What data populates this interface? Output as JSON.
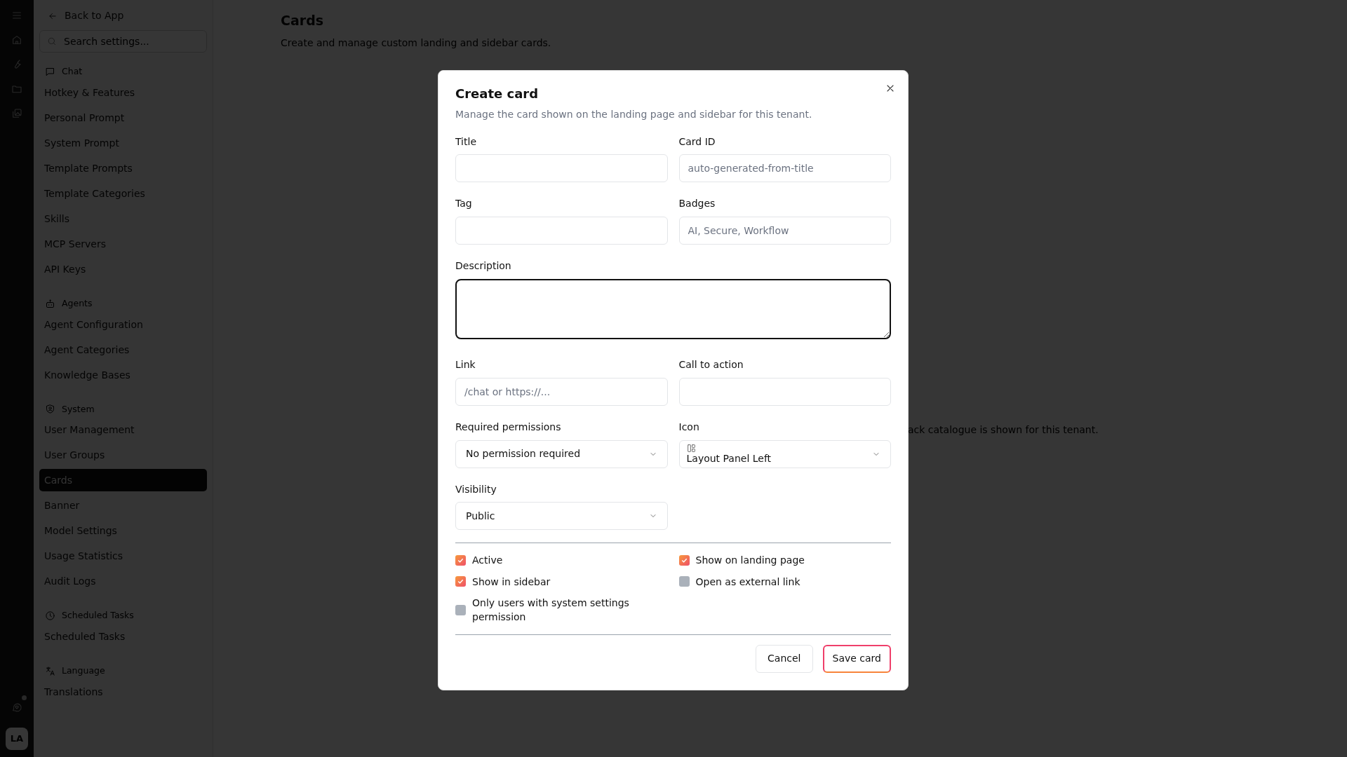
{
  "rail": {
    "notification": true,
    "avatar": "LA"
  },
  "sidebar": {
    "back_link": "Back to App",
    "search": {
      "placeholder": "Search settings..."
    },
    "sections": [
      {
        "kind": "chat",
        "title": "Chat",
        "items": [
          {
            "label": "Hotkey & Features",
            "selected": false
          },
          {
            "label": "Personal Prompt",
            "selected": false
          },
          {
            "label": "System Prompt",
            "selected": false
          },
          {
            "label": "Template Prompts",
            "selected": false
          },
          {
            "label": "Template Categories",
            "selected": false
          },
          {
            "label": "Skills",
            "selected": false
          },
          {
            "label": "MCP Servers",
            "selected": false
          },
          {
            "label": "API Keys",
            "selected": false
          }
        ]
      },
      {
        "kind": "agents",
        "title": "Agents",
        "items": [
          {
            "label": "Agent Configuration",
            "selected": false
          },
          {
            "label": "Agent Categories",
            "selected": false
          },
          {
            "label": "Knowledge Bases",
            "selected": false
          }
        ]
      },
      {
        "kind": "system",
        "title": "System",
        "items": [
          {
            "label": "User Management",
            "selected": false
          },
          {
            "label": "User Groups",
            "selected": false
          },
          {
            "label": "Cards",
            "selected": true
          },
          {
            "label": "Banner",
            "selected": false
          },
          {
            "label": "Model Settings",
            "selected": false
          },
          {
            "label": "Usage Statistics",
            "selected": false
          },
          {
            "label": "Audit Logs",
            "selected": false
          }
        ]
      },
      {
        "kind": "tasks",
        "title": "Scheduled Tasks",
        "items": [
          {
            "label": "Scheduled Tasks",
            "selected": false
          }
        ]
      },
      {
        "kind": "language",
        "title": "Language",
        "items": [
          {
            "label": "Translations",
            "selected": false
          }
        ]
      }
    ]
  },
  "main": {
    "title": "Cards",
    "subtitle": "Create and manage custom landing and sidebar cards.",
    "partial_text": "ack catalogue is shown for this tenant."
  },
  "modal": {
    "title": "Create card",
    "description": "Manage the card shown on the landing page and sidebar for this tenant.",
    "fields": [
      {
        "kind": "input",
        "label": "Title",
        "focused": false
      },
      {
        "kind": "input",
        "label": "Card ID",
        "placeholder": "auto-generated-from-title",
        "focused": false
      },
      {
        "kind": "input",
        "label": "Tag",
        "focused": false
      },
      {
        "kind": "input",
        "label": "Badges",
        "placeholder": "AI, Secure, Workflow",
        "focused": false
      },
      {
        "kind": "textarea",
        "label": "Description",
        "focused": true
      },
      {
        "kind": "input",
        "label": "Link",
        "placeholder": "/chat or https://...",
        "focused": false
      },
      {
        "kind": "input",
        "label": "Call to action",
        "focused": false
      },
      {
        "kind": "select",
        "label": "Required permissions",
        "value": "No permission required",
        "focused": false
      },
      {
        "kind": "icon-select",
        "label": "Icon",
        "value": "Layout Panel Left",
        "focused": false
      },
      {
        "kind": "select",
        "label": "Visibility",
        "value": "Public",
        "focused": false
      }
    ],
    "checkboxes": [
      {
        "label": "Active",
        "checked": true
      },
      {
        "label": "Show on landing page",
        "checked": true
      },
      {
        "label": "Show in sidebar",
        "checked": true
      },
      {
        "label": "Open as external link",
        "checked": false
      },
      {
        "label": "Only users with system settings permission",
        "checked": false
      }
    ],
    "buttons": [
      {
        "label": "Cancel",
        "kind": "secondary"
      },
      {
        "label": "Save card",
        "kind": "primary"
      }
    ]
  }
}
